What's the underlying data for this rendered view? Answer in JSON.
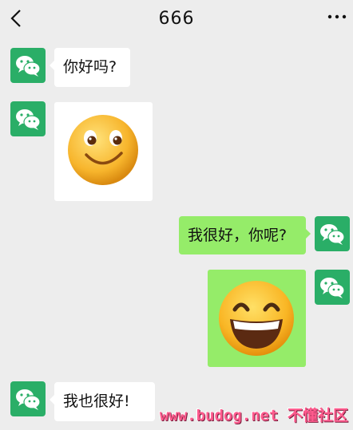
{
  "header": {
    "title": "666",
    "back_icon": "chevron-left-icon",
    "more_icon": "ellipsis-icon"
  },
  "messages": [
    {
      "side": "left",
      "type": "text",
      "text": "你好吗?"
    },
    {
      "side": "left",
      "type": "sticker",
      "sticker": "smile-emoji"
    },
    {
      "side": "right",
      "type": "text",
      "text": "我很好，你呢?"
    },
    {
      "side": "right",
      "type": "sticker",
      "sticker": "grin-emoji"
    },
    {
      "side": "left",
      "type": "text",
      "text": "我也很好!"
    }
  ],
  "colors": {
    "background": "#ededed",
    "sent_bubble": "#95ec69",
    "received_bubble": "#ffffff",
    "avatar": "#2aae67"
  },
  "watermark": "www.budog.net 不懂社区"
}
